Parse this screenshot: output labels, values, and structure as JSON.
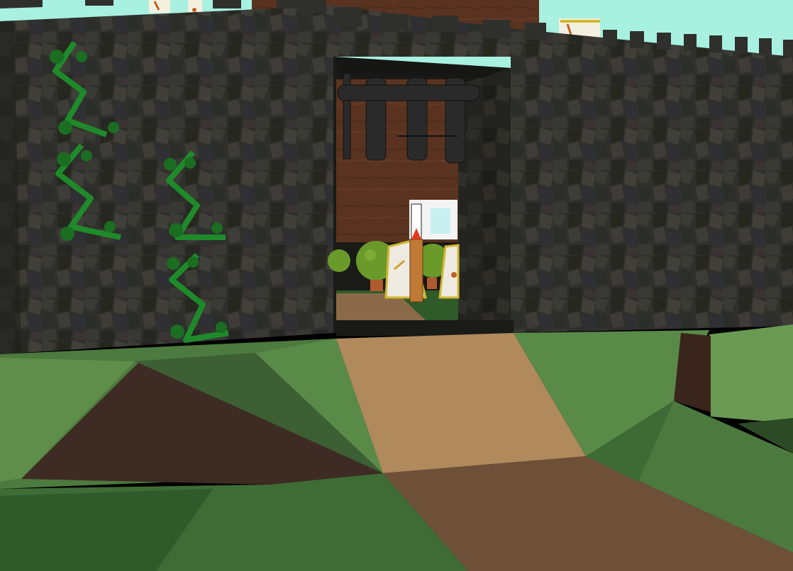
{
  "scene": {
    "kind": "3d-game-viewport",
    "description_tags": [
      "castle-wall",
      "gatehouse",
      "portcullis",
      "vines",
      "dirt-path",
      "grass-terrain",
      "courtyard",
      "topiary-bushes",
      "banners",
      "torch-post"
    ]
  },
  "colors": {
    "sky": "#a8f0e0",
    "wall_stone": "#2f302c",
    "wall_stone_light": "#45463f",
    "wall_wood": "#5a3320",
    "portcullis": "#2a2a2a",
    "vine": "#1e8a2a",
    "grass_light": "#5f8a4a",
    "grass_dark": "#3f6c35",
    "dirt_path": "#b08a5c",
    "dirt_dark": "#4a3528",
    "path_lower": "#6e5038",
    "bush": "#6a9a2a",
    "torch": "#c07a35",
    "flame": "#e03a1a"
  },
  "icons": {
    "vine_left_outer": "vine-icon",
    "vine_left_inner": "vine-icon",
    "banner": "banner-icon",
    "bush": "topiary-icon",
    "torch": "torch-icon"
  }
}
